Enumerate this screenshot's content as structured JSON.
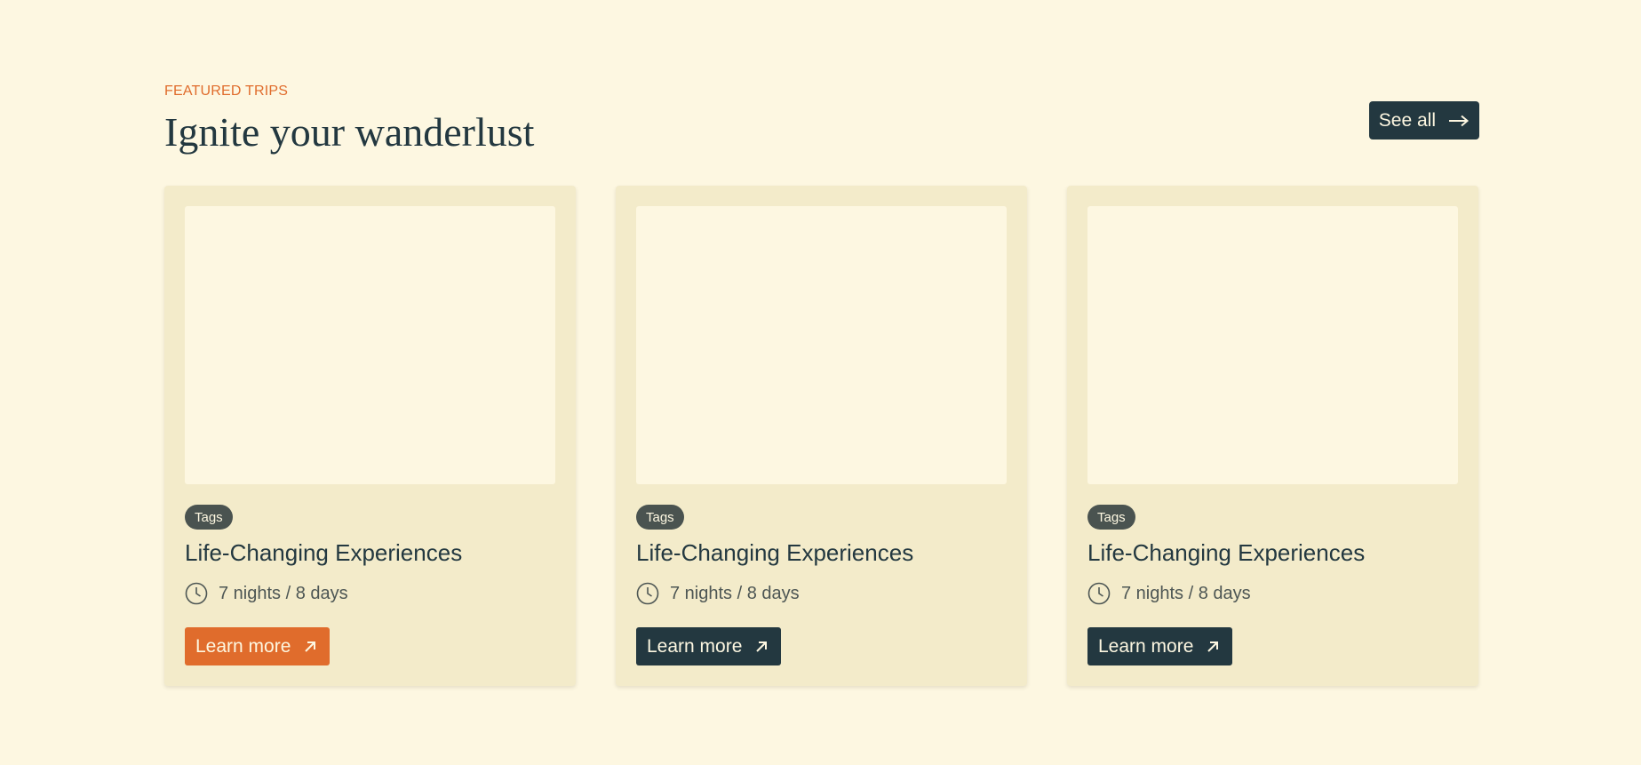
{
  "section": {
    "eyebrow": "FEATURED TRIPS",
    "heading": "Ignite your wanderlust",
    "see_all_label": "See all",
    "see_all_icon": "arrow-right-icon"
  },
  "colors": {
    "background": "#fdf7e1",
    "card": "#f3ebca",
    "accent": "#e06c2c",
    "dark": "#233840",
    "tag": "#4a5350"
  },
  "cards": [
    {
      "tag": "Tags",
      "title": "Life-Changing Experiences",
      "duration": "7 nights / 8 days",
      "button_label": "Learn more",
      "button_style": "accent"
    },
    {
      "tag": "Tags",
      "title": "Life-Changing Experiences",
      "duration": "7 nights / 8 days",
      "button_label": "Learn more",
      "button_style": "dark"
    },
    {
      "tag": "Tags",
      "title": "Life-Changing Experiences",
      "duration": "7 nights / 8 days",
      "button_label": "Learn more",
      "button_style": "dark"
    }
  ]
}
